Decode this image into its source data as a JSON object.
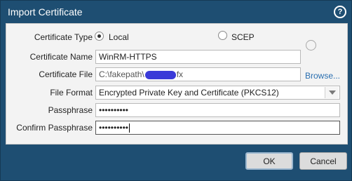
{
  "dialog": {
    "title": "Import Certificate",
    "help_symbol": "?"
  },
  "form": {
    "certificate_type": {
      "label": "Certificate Type",
      "options": [
        {
          "label": "Local",
          "selected": true
        },
        {
          "label": "SCEP",
          "selected": false
        }
      ]
    },
    "certificate_name": {
      "label": "Certificate Name",
      "value": "WinRM-HTTPS"
    },
    "certificate_file": {
      "label": "Certificate File",
      "value_prefix": "C:\\fakepath\\",
      "value_suffix": "fx",
      "browse_label": "Browse..."
    },
    "file_format": {
      "label": "File Format",
      "value": "Encrypted Private Key and Certificate (PKCS12)"
    },
    "passphrase": {
      "label": "Passphrase",
      "value": "••••••••••"
    },
    "confirm_passphrase": {
      "label": "Confirm Passphrase",
      "value": "••••••••••"
    }
  },
  "buttons": {
    "ok_label": "OK",
    "cancel_label": "Cancel"
  },
  "colors": {
    "titlebar": "#1e4e72",
    "panel": "#f3f3f3",
    "link": "#2a6fb0",
    "redaction": "#3a3ad8"
  }
}
